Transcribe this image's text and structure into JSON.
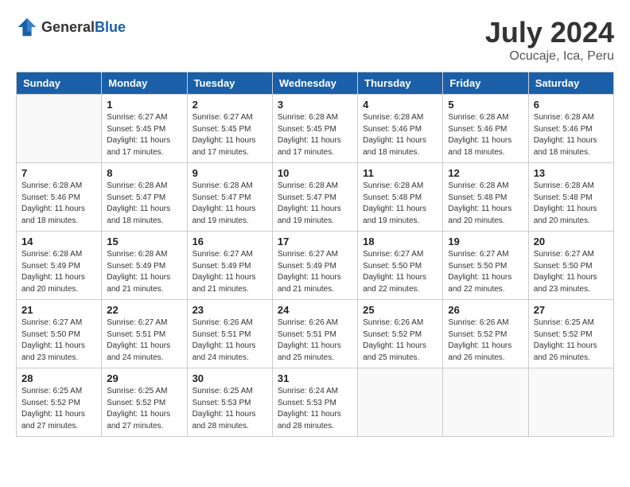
{
  "header": {
    "logo_general": "General",
    "logo_blue": "Blue",
    "title": "July 2024",
    "location": "Ocucaje, Ica, Peru"
  },
  "calendar": {
    "days_of_week": [
      "Sunday",
      "Monday",
      "Tuesday",
      "Wednesday",
      "Thursday",
      "Friday",
      "Saturday"
    ],
    "weeks": [
      [
        {
          "day": "",
          "info": ""
        },
        {
          "day": "1",
          "info": "Sunrise: 6:27 AM\nSunset: 5:45 PM\nDaylight: 11 hours\nand 17 minutes."
        },
        {
          "day": "2",
          "info": "Sunrise: 6:27 AM\nSunset: 5:45 PM\nDaylight: 11 hours\nand 17 minutes."
        },
        {
          "day": "3",
          "info": "Sunrise: 6:28 AM\nSunset: 5:45 PM\nDaylight: 11 hours\nand 17 minutes."
        },
        {
          "day": "4",
          "info": "Sunrise: 6:28 AM\nSunset: 5:46 PM\nDaylight: 11 hours\nand 18 minutes."
        },
        {
          "day": "5",
          "info": "Sunrise: 6:28 AM\nSunset: 5:46 PM\nDaylight: 11 hours\nand 18 minutes."
        },
        {
          "day": "6",
          "info": "Sunrise: 6:28 AM\nSunset: 5:46 PM\nDaylight: 11 hours\nand 18 minutes."
        }
      ],
      [
        {
          "day": "7",
          "info": "Sunrise: 6:28 AM\nSunset: 5:46 PM\nDaylight: 11 hours\nand 18 minutes."
        },
        {
          "day": "8",
          "info": "Sunrise: 6:28 AM\nSunset: 5:47 PM\nDaylight: 11 hours\nand 18 minutes."
        },
        {
          "day": "9",
          "info": "Sunrise: 6:28 AM\nSunset: 5:47 PM\nDaylight: 11 hours\nand 19 minutes."
        },
        {
          "day": "10",
          "info": "Sunrise: 6:28 AM\nSunset: 5:47 PM\nDaylight: 11 hours\nand 19 minutes."
        },
        {
          "day": "11",
          "info": "Sunrise: 6:28 AM\nSunset: 5:48 PM\nDaylight: 11 hours\nand 19 minutes."
        },
        {
          "day": "12",
          "info": "Sunrise: 6:28 AM\nSunset: 5:48 PM\nDaylight: 11 hours\nand 20 minutes."
        },
        {
          "day": "13",
          "info": "Sunrise: 6:28 AM\nSunset: 5:48 PM\nDaylight: 11 hours\nand 20 minutes."
        }
      ],
      [
        {
          "day": "14",
          "info": "Sunrise: 6:28 AM\nSunset: 5:49 PM\nDaylight: 11 hours\nand 20 minutes."
        },
        {
          "day": "15",
          "info": "Sunrise: 6:28 AM\nSunset: 5:49 PM\nDaylight: 11 hours\nand 21 minutes."
        },
        {
          "day": "16",
          "info": "Sunrise: 6:27 AM\nSunset: 5:49 PM\nDaylight: 11 hours\nand 21 minutes."
        },
        {
          "day": "17",
          "info": "Sunrise: 6:27 AM\nSunset: 5:49 PM\nDaylight: 11 hours\nand 21 minutes."
        },
        {
          "day": "18",
          "info": "Sunrise: 6:27 AM\nSunset: 5:50 PM\nDaylight: 11 hours\nand 22 minutes."
        },
        {
          "day": "19",
          "info": "Sunrise: 6:27 AM\nSunset: 5:50 PM\nDaylight: 11 hours\nand 22 minutes."
        },
        {
          "day": "20",
          "info": "Sunrise: 6:27 AM\nSunset: 5:50 PM\nDaylight: 11 hours\nand 23 minutes."
        }
      ],
      [
        {
          "day": "21",
          "info": "Sunrise: 6:27 AM\nSunset: 5:50 PM\nDaylight: 11 hours\nand 23 minutes."
        },
        {
          "day": "22",
          "info": "Sunrise: 6:27 AM\nSunset: 5:51 PM\nDaylight: 11 hours\nand 24 minutes."
        },
        {
          "day": "23",
          "info": "Sunrise: 6:26 AM\nSunset: 5:51 PM\nDaylight: 11 hours\nand 24 minutes."
        },
        {
          "day": "24",
          "info": "Sunrise: 6:26 AM\nSunset: 5:51 PM\nDaylight: 11 hours\nand 25 minutes."
        },
        {
          "day": "25",
          "info": "Sunrise: 6:26 AM\nSunset: 5:52 PM\nDaylight: 11 hours\nand 25 minutes."
        },
        {
          "day": "26",
          "info": "Sunrise: 6:26 AM\nSunset: 5:52 PM\nDaylight: 11 hours\nand 26 minutes."
        },
        {
          "day": "27",
          "info": "Sunrise: 6:25 AM\nSunset: 5:52 PM\nDaylight: 11 hours\nand 26 minutes."
        }
      ],
      [
        {
          "day": "28",
          "info": "Sunrise: 6:25 AM\nSunset: 5:52 PM\nDaylight: 11 hours\nand 27 minutes."
        },
        {
          "day": "29",
          "info": "Sunrise: 6:25 AM\nSunset: 5:52 PM\nDaylight: 11 hours\nand 27 minutes."
        },
        {
          "day": "30",
          "info": "Sunrise: 6:25 AM\nSunset: 5:53 PM\nDaylight: 11 hours\nand 28 minutes."
        },
        {
          "day": "31",
          "info": "Sunrise: 6:24 AM\nSunset: 5:53 PM\nDaylight: 11 hours\nand 28 minutes."
        },
        {
          "day": "",
          "info": ""
        },
        {
          "day": "",
          "info": ""
        },
        {
          "day": "",
          "info": ""
        }
      ]
    ]
  }
}
